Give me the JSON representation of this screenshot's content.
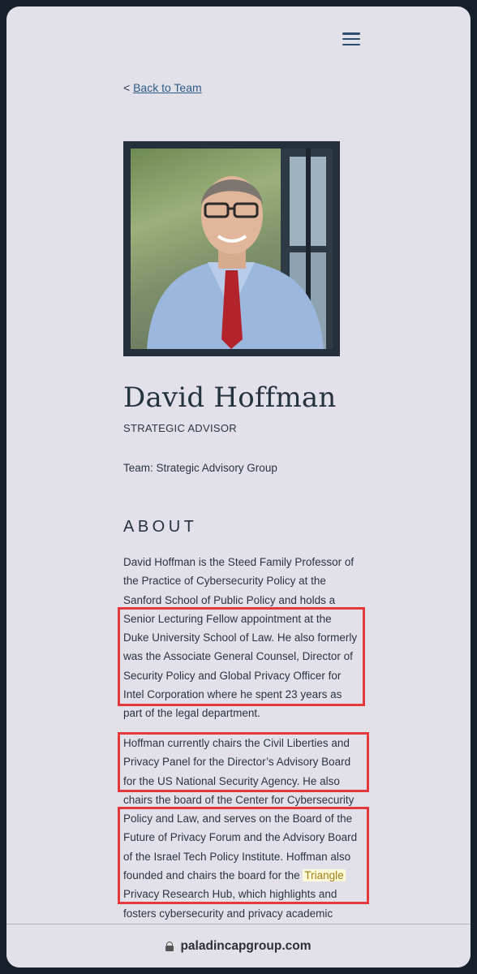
{
  "nav": {
    "menu_icon": "hamburger-menu-icon"
  },
  "back_link": {
    "prefix": "<",
    "label": "Back to Team"
  },
  "profile": {
    "photo_alt": "Portrait of David Hoffman",
    "name": "David Hoffman",
    "role": "STRATEGIC ADVISOR",
    "team": "Team: Strategic Advisory Group"
  },
  "about": {
    "heading": "ABOUT",
    "para1_lines": [
      "David Hoffman is the Steed Family Professor of",
      "the Practice of Cybersecurity Policy at the",
      "Sanford School of Public Policy and holds a",
      "Senior Lecturing Fellow appointment at the",
      "Duke University School of Law. He also formerly",
      "was the Associate General Counsel, Director of",
      "Security Policy and Global Privacy Officer for",
      "Intel Corporation where he spent 23 years as",
      "part of the legal department."
    ],
    "para2_lines": [
      "Hoffman currently chairs the Civil Liberties and",
      "Privacy Panel for the Director’s Advisory Board",
      "for the US National Security Agency. He also",
      "chairs the board of the Center for Cybersecurity",
      "Policy and Law, and serves on the Board of the",
      "Future of Privacy Forum and the Advisory Board",
      "of the Israel Tech Policy Institute. Hoffman also",
      "founded and chairs the board for the",
      "Privacy Research Hub, which highlights and",
      "fosters cybersecurity and privacy academic"
    ],
    "highlight_word": "Triangle"
  },
  "browser": {
    "url": "paladincapgroup.com",
    "lock_icon": "lock-icon"
  },
  "colors": {
    "annotation_red": "#e5383b",
    "link_blue": "#2c5a86",
    "background": "#e2e1ea"
  }
}
